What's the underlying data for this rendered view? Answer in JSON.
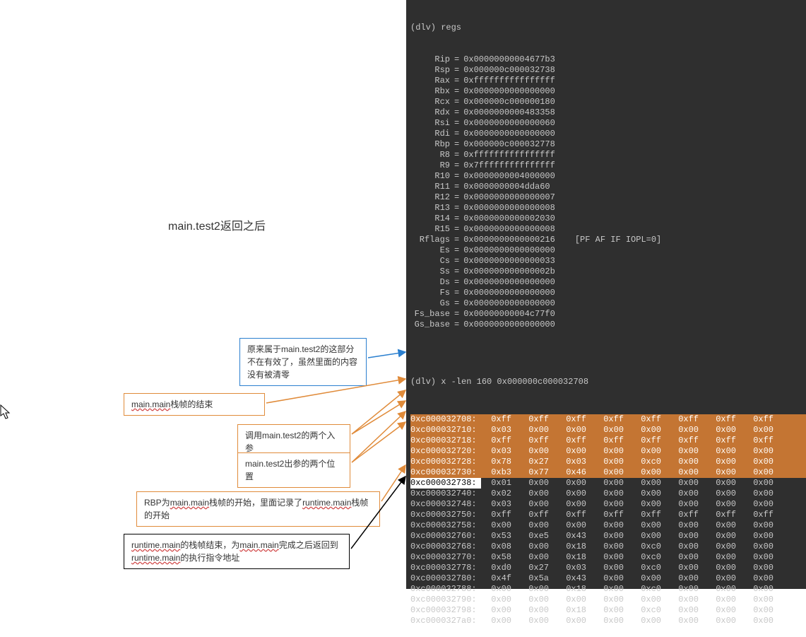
{
  "title": "main.test2返回之后",
  "prompt1": "(dlv) regs",
  "regs": [
    {
      "n": "Rip",
      "v": "0x00000000004677b3"
    },
    {
      "n": "Rsp",
      "v": "0x000000c000032738"
    },
    {
      "n": "Rax",
      "v": "0xffffffffffffffff"
    },
    {
      "n": "Rbx",
      "v": "0x0000000000000000"
    },
    {
      "n": "Rcx",
      "v": "0x000000c000000180"
    },
    {
      "n": "Rdx",
      "v": "0x0000000000483358"
    },
    {
      "n": "Rsi",
      "v": "0x0000000000000060"
    },
    {
      "n": "Rdi",
      "v": "0x0000000000000000"
    },
    {
      "n": "Rbp",
      "v": "0x000000c000032778"
    },
    {
      "n": "R8",
      "v": "0xffffffffffffffff"
    },
    {
      "n": "R9",
      "v": "0x7fffffffffffffff"
    },
    {
      "n": "R10",
      "v": "0x0000000004000000"
    },
    {
      "n": "R11",
      "v": "0x0000000004dda60"
    },
    {
      "n": "R12",
      "v": "0x0000000000000007"
    },
    {
      "n": "R13",
      "v": "0x0000000000000008"
    },
    {
      "n": "R14",
      "v": "0x0000000000002030"
    },
    {
      "n": "R15",
      "v": "0x0000000000000008"
    },
    {
      "n": "Rflags",
      "v": "0x0000000000000216",
      "flags": "[PF AF IF IOPL=0]"
    },
    {
      "n": "Es",
      "v": "0x0000000000000000"
    },
    {
      "n": "Cs",
      "v": "0x0000000000000033"
    },
    {
      "n": "Ss",
      "v": "0x000000000000002b"
    },
    {
      "n": "Ds",
      "v": "0x0000000000000000"
    },
    {
      "n": "Fs",
      "v": "0x0000000000000000"
    },
    {
      "n": "Gs",
      "v": "0x0000000000000000"
    },
    {
      "n": "Fs_base",
      "v": "0x00000000004c77f0"
    },
    {
      "n": "Gs_base",
      "v": "0x0000000000000000"
    }
  ],
  "prompt2": "(dlv) x -len 160 0x000000c000032708",
  "mem": [
    {
      "addr": "0xc000032708:",
      "cells": [
        "0xff",
        "0xff",
        "0xff",
        "0xff",
        "0xff",
        "0xff",
        "0xff",
        "0xff"
      ],
      "hl": "orange"
    },
    {
      "addr": "0xc000032710:",
      "cells": [
        "0x03",
        "0x00",
        "0x00",
        "0x00",
        "0x00",
        "0x00",
        "0x00",
        "0x00"
      ],
      "hl": "orange"
    },
    {
      "addr": "0xc000032718:",
      "cells": [
        "0xff",
        "0xff",
        "0xff",
        "0xff",
        "0xff",
        "0xff",
        "0xff",
        "0xff"
      ],
      "hl": "orange"
    },
    {
      "addr": "0xc000032720:",
      "cells": [
        "0x03",
        "0x00",
        "0x00",
        "0x00",
        "0x00",
        "0x00",
        "0x00",
        "0x00"
      ],
      "hl": "orange"
    },
    {
      "addr": "0xc000032728:",
      "cells": [
        "0x78",
        "0x27",
        "0x03",
        "0x00",
        "0xc0",
        "0x00",
        "0x00",
        "0x00"
      ],
      "hl": "orange"
    },
    {
      "addr": "0xc000032730:",
      "cells": [
        "0xb3",
        "0x77",
        "0x46",
        "0x00",
        "0x00",
        "0x00",
        "0x00",
        "0x00"
      ],
      "hl": "orange"
    },
    {
      "addr": "0xc000032738:",
      "cells": [
        "0x01",
        "0x00",
        "0x00",
        "0x00",
        "0x00",
        "0x00",
        "0x00",
        "0x00"
      ],
      "hl": "white"
    },
    {
      "addr": "0xc000032740:",
      "cells": [
        "0x02",
        "0x00",
        "0x00",
        "0x00",
        "0x00",
        "0x00",
        "0x00",
        "0x00"
      ]
    },
    {
      "addr": "0xc000032748:",
      "cells": [
        "0x03",
        "0x00",
        "0x00",
        "0x00",
        "0x00",
        "0x00",
        "0x00",
        "0x00"
      ]
    },
    {
      "addr": "0xc000032750:",
      "cells": [
        "0xff",
        "0xff",
        "0xff",
        "0xff",
        "0xff",
        "0xff",
        "0xff",
        "0xff"
      ]
    },
    {
      "addr": "0xc000032758:",
      "cells": [
        "0x00",
        "0x00",
        "0x00",
        "0x00",
        "0x00",
        "0x00",
        "0x00",
        "0x00"
      ]
    },
    {
      "addr": "0xc000032760:",
      "cells": [
        "0x53",
        "0xe5",
        "0x43",
        "0x00",
        "0x00",
        "0x00",
        "0x00",
        "0x00"
      ]
    },
    {
      "addr": "0xc000032768:",
      "cells": [
        "0x08",
        "0x00",
        "0x18",
        "0x00",
        "0xc0",
        "0x00",
        "0x00",
        "0x00"
      ]
    },
    {
      "addr": "0xc000032770:",
      "cells": [
        "0x58",
        "0x00",
        "0x18",
        "0x00",
        "0xc0",
        "0x00",
        "0x00",
        "0x00"
      ]
    },
    {
      "addr": "0xc000032778:",
      "cells": [
        "0xd0",
        "0x27",
        "0x03",
        "0x00",
        "0xc0",
        "0x00",
        "0x00",
        "0x00"
      ]
    },
    {
      "addr": "0xc000032780:",
      "cells": [
        "0x4f",
        "0x5a",
        "0x43",
        "0x00",
        "0x00",
        "0x00",
        "0x00",
        "0x00"
      ]
    },
    {
      "addr": "0xc000032788:",
      "cells": [
        "0x00",
        "0x00",
        "0x18",
        "0x00",
        "0xc0",
        "0x00",
        "0x00",
        "0x00"
      ]
    },
    {
      "addr": "0xc000032790:",
      "cells": [
        "0x00",
        "0x00",
        "0x00",
        "0x00",
        "0x00",
        "0x00",
        "0x00",
        "0x00"
      ]
    },
    {
      "addr": "0xc000032798:",
      "cells": [
        "0x00",
        "0x00",
        "0x18",
        "0x00",
        "0xc0",
        "0x00",
        "0x00",
        "0x00"
      ]
    },
    {
      "addr": "0xc0000327a0:",
      "cells": [
        "0x00",
        "0x00",
        "0x00",
        "0x00",
        "0x00",
        "0x00",
        "0x00",
        "0x00"
      ]
    }
  ],
  "callouts": {
    "c1": "原来属于main.test2的这部分不在有效了，虽然里面的内容没有被清零",
    "c2_a": "main.main",
    "c2_b": "栈帧的结束",
    "c3": "调用main.test2的两个入参",
    "c4": "main.test2出参的两个位置",
    "c5_a": "RBP为",
    "c5_b": "main.main",
    "c5_c": "栈帧的开始，里面记录了",
    "c5_d": "runtime.main",
    "c5_e": "栈帧的开始",
    "c6_a": "runtime.main",
    "c6_b": "的栈帧结束，为",
    "c6_c": "main.main",
    "c6_d": "完成之后返回到",
    "c6_e": "runtime.main",
    "c6_f": "的执行指令地址"
  }
}
